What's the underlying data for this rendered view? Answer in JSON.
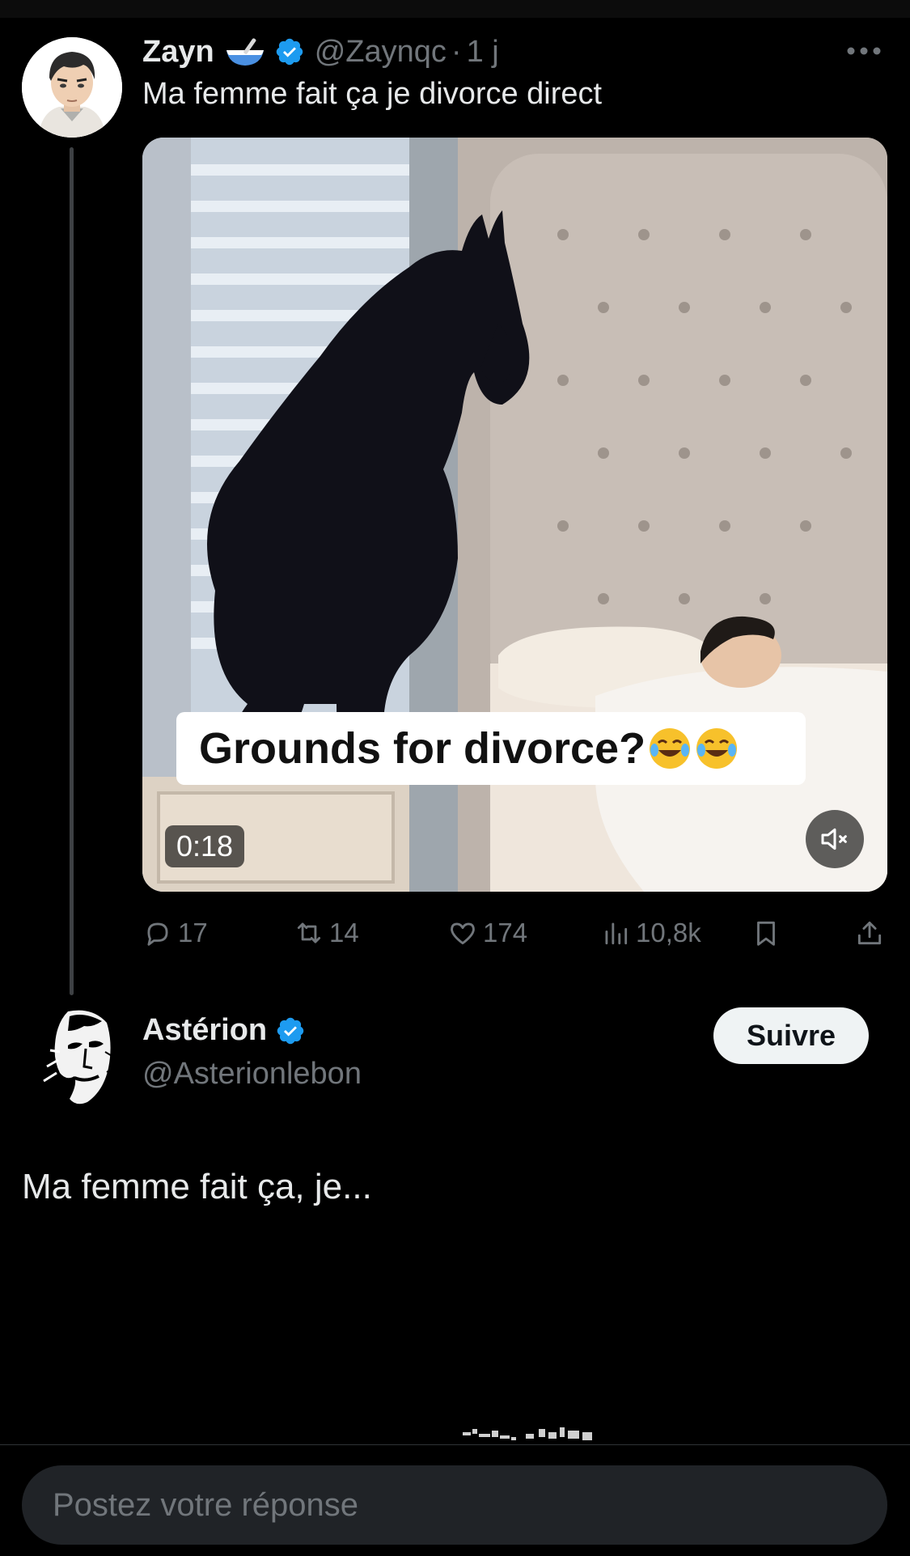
{
  "parent_tweet": {
    "author_name": "Zayn",
    "handle": "@Zaynqc",
    "separator": "·",
    "time": "1 j",
    "text": "Ma femme fait ça je divorce direct",
    "video": {
      "caption": "Grounds for divorce?",
      "duration": "0:18"
    },
    "stats": {
      "replies": "17",
      "reposts": "14",
      "likes": "174",
      "views": "10,8k"
    }
  },
  "reply_author": {
    "name": "Astérion",
    "handle": "@Asterionlebon",
    "follow_label": "Suivre"
  },
  "reply_text": "Ma femme fait ça, je...",
  "compose": {
    "placeholder": "Postez votre réponse"
  },
  "icons": {
    "verified": "verified-badge-icon",
    "more": "more-options-icon",
    "reply": "reply-icon",
    "repost": "repost-icon",
    "like": "heart-icon",
    "views": "views-icon",
    "bookmark": "bookmark-icon",
    "share": "share-icon",
    "mute": "speaker-muted-icon"
  },
  "colors": {
    "background": "#000000",
    "text": "#e7e9ea",
    "secondary_text": "#71767b",
    "verified": "#1d9bf0",
    "follow_button_bg": "#eff3f4",
    "compose_bg": "#202327"
  }
}
